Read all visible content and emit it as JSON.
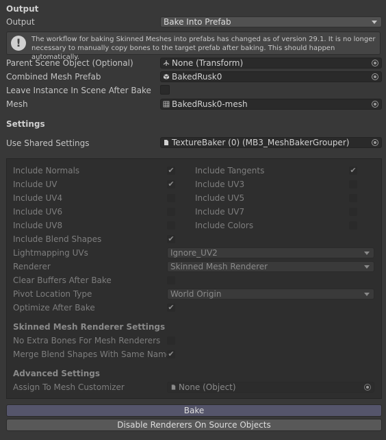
{
  "output_section": {
    "header": "Output",
    "output_label": "Output",
    "output_value": "Bake Into Prefab",
    "help_text": "The workflow for baking Skinned Meshes into prefabs has changed as of version 29.1. It is no longer necessary to manually copy bones to the target prefab after baking. This should happen automatically.",
    "parent_label": "Parent Scene Object (Optional)",
    "parent_value": "None (Transform)",
    "prefab_label": "Combined Mesh Prefab",
    "prefab_value": "BakedRusk0",
    "leave_label": "Leave Instance In Scene After Bake",
    "mesh_label": "Mesh",
    "mesh_value": "BakedRusk0-mesh"
  },
  "settings_section": {
    "header": "Settings",
    "shared_label": "Use Shared Settings",
    "shared_value": "TextureBaker (0) (MB3_MeshBakerGrouper)"
  },
  "panel": {
    "include_normals": "Include Normals",
    "include_tangents": "Include Tangents",
    "include_uv": "Include UV",
    "include_uv3": "Include UV3",
    "include_uv4": "Include UV4",
    "include_uv5": "Include UV5",
    "include_uv6": "Include UV6",
    "include_uv7": "Include UV7",
    "include_uv8": "Include UV8",
    "include_colors": "Include Colors",
    "include_blend": "Include Blend Shapes",
    "lightmapping_label": "Lightmapping UVs",
    "lightmapping_value": "Ignore_UV2",
    "renderer_label": "Renderer",
    "renderer_value": "Skinned Mesh Renderer",
    "clear_buffers": "Clear Buffers After Bake",
    "pivot_label": "Pivot Location Type",
    "pivot_value": "World Origin",
    "optimize": "Optimize After Bake",
    "skinned_header": "Skinned Mesh Renderer Settings",
    "no_extra_bones": "No Extra Bones For Mesh Renderers",
    "merge_blend": "Merge Blend Shapes With Same Names",
    "advanced_header": "Advanced Settings",
    "assign_label": "Assign To Mesh Customizer",
    "assign_value": "None (Object)",
    "checkmark": "✔"
  },
  "buttons": {
    "bake": "Bake",
    "disable": "Disable Renderers On Source Objects"
  },
  "colors": {
    "background": "#383838",
    "panel": "#2e2e2e",
    "field": "#2a2a2a"
  }
}
